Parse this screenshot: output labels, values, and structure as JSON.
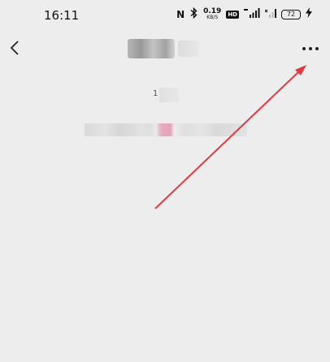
{
  "status_bar": {
    "time": "16:11",
    "nfc_icon": "N",
    "bluetooth_icon": "bluetooth-icon",
    "net_speed_value": "0.19",
    "net_speed_unit": "KB/S",
    "hd_badge": "HD",
    "signal_icon": "signal-icon",
    "battery": "72",
    "charging_icon": "charging-bolt-icon"
  },
  "nav": {
    "back_icon": "chevron-left-icon",
    "more_icon": "more-horizontal-icon"
  },
  "content": {
    "digit": "1"
  },
  "annotation": {
    "arrow_color": "#e0393e"
  },
  "colors": {
    "background": "#ededed",
    "pink_accent": "#e8a9c0"
  }
}
